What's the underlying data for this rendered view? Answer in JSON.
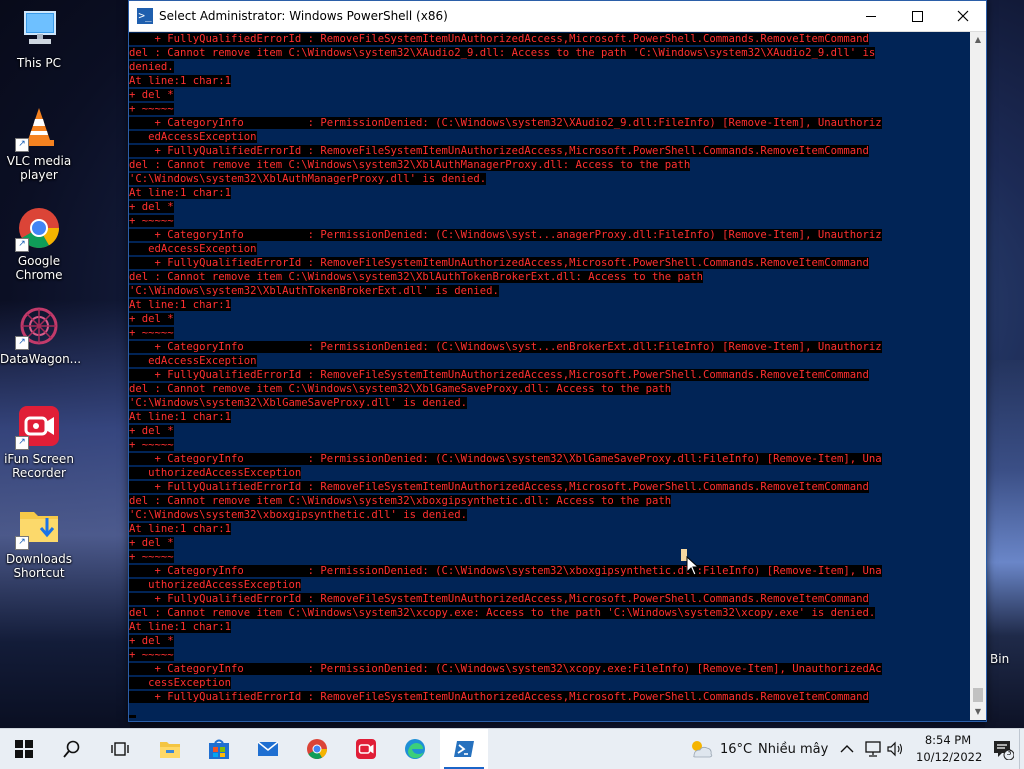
{
  "desktop": {
    "icons": [
      {
        "label": "This PC"
      },
      {
        "label": "VLC media player"
      },
      {
        "label": "Google Chrome"
      },
      {
        "label": "DataWagon..."
      },
      {
        "label": "iFun Screen Recorder"
      },
      {
        "label": "Downloads Shortcut"
      }
    ],
    "right_edge_text": "Bin"
  },
  "window": {
    "title": "Select Administrator: Windows PowerShell (x86)",
    "console_lines": [
      "    + FullyQualifiedErrorId : RemoveFileSystemItemUnAuthorizedAccess,Microsoft.PowerShell.Commands.RemoveItemCommand",
      "del : Cannot remove item C:\\Windows\\system32\\XAudio2_9.dll: Access to the path 'C:\\Windows\\system32\\XAudio2_9.dll' is",
      "denied.",
      "At line:1 char:1",
      "+ del *",
      "+ ~~~~~",
      "    + CategoryInfo          : PermissionDenied: (C:\\Windows\\system32\\XAudio2_9.dll:FileInfo) [Remove-Item], Unauthoriz",
      "   edAccessException",
      "    + FullyQualifiedErrorId : RemoveFileSystemItemUnAuthorizedAccess,Microsoft.PowerShell.Commands.RemoveItemCommand",
      "del : Cannot remove item C:\\Windows\\system32\\XblAuthManagerProxy.dll: Access to the path",
      "'C:\\Windows\\system32\\XblAuthManagerProxy.dll' is denied.",
      "At line:1 char:1",
      "+ del *",
      "+ ~~~~~",
      "    + CategoryInfo          : PermissionDenied: (C:\\Windows\\syst...anagerProxy.dll:FileInfo) [Remove-Item], Unauthoriz",
      "   edAccessException",
      "    + FullyQualifiedErrorId : RemoveFileSystemItemUnAuthorizedAccess,Microsoft.PowerShell.Commands.RemoveItemCommand",
      "del : Cannot remove item C:\\Windows\\system32\\XblAuthTokenBrokerExt.dll: Access to the path",
      "'C:\\Windows\\system32\\XblAuthTokenBrokerExt.dll' is denied.",
      "At line:1 char:1",
      "+ del *",
      "+ ~~~~~",
      "    + CategoryInfo          : PermissionDenied: (C:\\Windows\\syst...enBrokerExt.dll:FileInfo) [Remove-Item], Unauthoriz",
      "   edAccessException",
      "    + FullyQualifiedErrorId : RemoveFileSystemItemUnAuthorizedAccess,Microsoft.PowerShell.Commands.RemoveItemCommand",
      "del : Cannot remove item C:\\Windows\\system32\\XblGameSaveProxy.dll: Access to the path",
      "'C:\\Windows\\system32\\XblGameSaveProxy.dll' is denied.",
      "At line:1 char:1",
      "+ del *",
      "+ ~~~~~",
      "    + CategoryInfo          : PermissionDenied: (C:\\Windows\\system32\\XblGameSaveProxy.dll:FileInfo) [Remove-Item], Una",
      "   uthorizedAccessException",
      "    + FullyQualifiedErrorId : RemoveFileSystemItemUnAuthorizedAccess,Microsoft.PowerShell.Commands.RemoveItemCommand",
      "del : Cannot remove item C:\\Windows\\system32\\xboxgipsynthetic.dll: Access to the path",
      "'C:\\Windows\\system32\\xboxgipsynthetic.dll' is denied.",
      "At line:1 char:1",
      "+ del *",
      "+ ~~~~~",
      "    + CategoryInfo          : PermissionDenied: (C:\\Windows\\system32\\xboxgipsynthetic.dll:FileInfo) [Remove-Item], Una",
      "   uthorizedAccessException",
      "    + FullyQualifiedErrorId : RemoveFileSystemItemUnAuthorizedAccess,Microsoft.PowerShell.Commands.RemoveItemCommand",
      "del : Cannot remove item C:\\Windows\\system32\\xcopy.exe: Access to the path 'C:\\Windows\\system32\\xcopy.exe' is denied.",
      "At line:1 char:1",
      "+ del *",
      "+ ~~~~~",
      "    + CategoryInfo          : PermissionDenied: (C:\\Windows\\system32\\xcopy.exe:FileInfo) [Remove-Item], UnauthorizedAc",
      "   cessException",
      "    + FullyQualifiedErrorId : RemoveFileSystemItemUnAuthorizedAccess,Microsoft.PowerShell.Commands.RemoveItemCommand"
    ]
  },
  "taskbar": {
    "weather_temp": "16°C",
    "weather_desc": "Nhiều mây",
    "time": "8:54 PM",
    "date": "10/12/2022",
    "notification_count": "3"
  },
  "colors": {
    "console_bg": "#012456",
    "error_fg": "#ff3030",
    "error_bg": "#000000",
    "taskbar_bg": "#e9eef4",
    "accent": "#1b65c8"
  }
}
